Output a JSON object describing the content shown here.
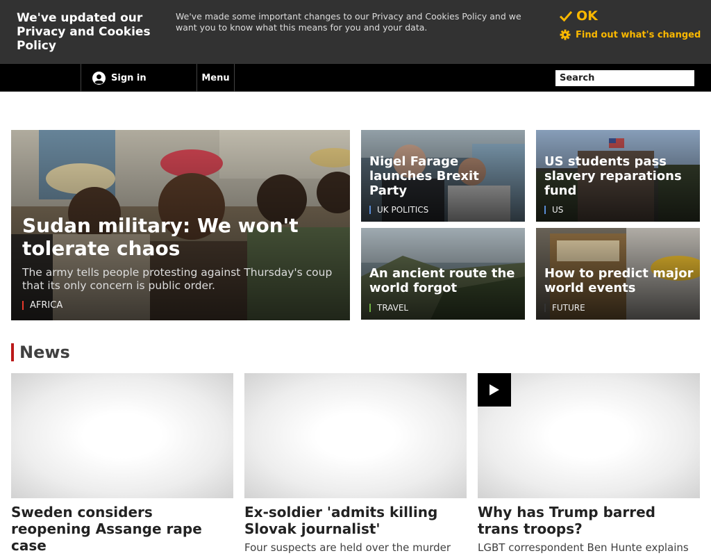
{
  "cookie_banner": {
    "title": "We've updated our Privacy and Cookies Policy",
    "text": "We've made some important changes to our Privacy and Cookies Policy and we want you to know what this means for you and your data.",
    "ok_label": "OK",
    "find_out_label": "Find out what's changed",
    "accent": "#fab800"
  },
  "nav": {
    "signin_label": "Sign in",
    "menu_label": "Menu",
    "search_placeholder": "Search"
  },
  "top_stories": {
    "hero": {
      "headline": "Sudan military: We won't tolerate chaos",
      "summary": "The army tells people protesting against Thursday's coup that its only concern is public order.",
      "tag": "AFRICA",
      "tag_color": "#e8392b"
    },
    "tiles": [
      {
        "headline": "Nigel Farage launches Brexit Party",
        "tag": "UK POLITICS",
        "tag_color": "#5a8dd6"
      },
      {
        "headline": "US students pass slavery reparations fund",
        "tag": "US",
        "tag_color": "#5a8dd6"
      },
      {
        "headline": "An ancient route the world forgot",
        "tag": "TRAVEL",
        "tag_color": "#6fb342"
      },
      {
        "headline": "How to predict major world events",
        "tag": "FUTURE",
        "tag_color": "#333333"
      }
    ]
  },
  "news": {
    "section_title": "News",
    "cards": [
      {
        "title": "Sweden considers reopening Assange rape case",
        "summary": ""
      },
      {
        "title": "Ex-soldier 'admits killing Slovak journalist'",
        "summary": "Four suspects are held over the murder"
      },
      {
        "title": "Why has Trump barred trans troops?",
        "summary": "LGBT correspondent Ben Hunte explains",
        "has_video": true
      }
    ]
  }
}
